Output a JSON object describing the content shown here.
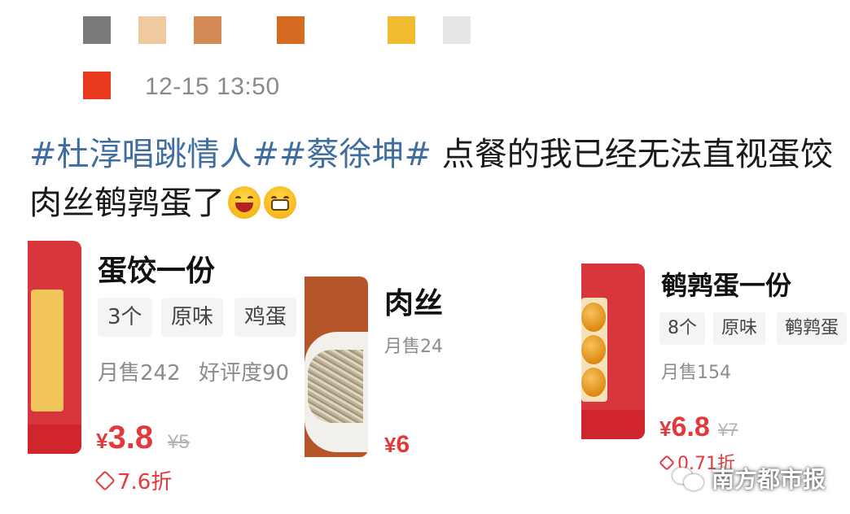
{
  "color_swatches": [
    "#7a7a7a",
    "#efc9a0",
    "#d48a55",
    "#d46b20",
    "#f0bb2e",
    "#e6e6e6",
    "#e8381e"
  ],
  "post": {
    "timestamp": "12-15 13:50",
    "hashtag_1": "#杜淳唱跳情人#",
    "hashtag_2": "#蔡徐坤#",
    "text": " 点餐的我已经无法直视蛋饺肉丝鹌鹑蛋了",
    "emojis": [
      "laughing-face-icon",
      "grinning-face-icon"
    ]
  },
  "items": [
    {
      "title": "蛋饺一份",
      "tags": [
        "3个",
        "原味",
        "鸡蛋"
      ],
      "sales": "月售242",
      "rating": "好评度90",
      "currency": "¥",
      "price": "3.8",
      "original_price": "¥5",
      "discount": "7.6折"
    },
    {
      "title": "肉丝",
      "sales": "月售24",
      "currency": "¥",
      "price": "6"
    },
    {
      "title": "鹌鹑蛋一份",
      "tags": [
        "8个",
        "原味",
        "鹌鹑蛋"
      ],
      "sales": "月售154",
      "currency": "¥",
      "price": "6.8",
      "original_price": "¥7",
      "discount": "0.71折"
    }
  ],
  "watermark": "南方都市报",
  "colors": {
    "hashtag": "#3f6d9f",
    "price": "#e4393c",
    "muted": "#8c8c8c"
  }
}
